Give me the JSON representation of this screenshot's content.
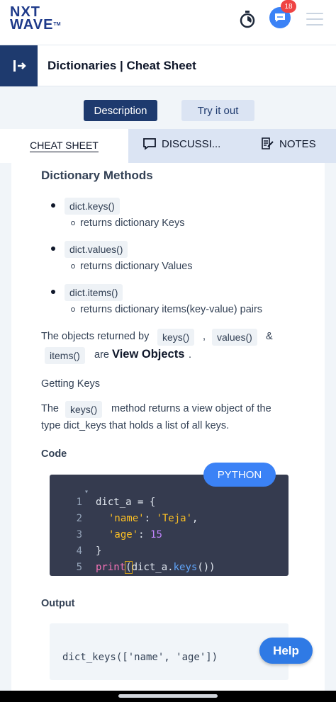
{
  "header": {
    "logo_line1": "NXT",
    "logo_line2": "WAVE",
    "logo_tm": "TM",
    "notification_count": "18"
  },
  "titlebar": {
    "title": "Dictionaries | Cheat Sheet",
    "back_icon": "collapse-arrow-icon"
  },
  "buttons": {
    "description": "Description",
    "try_it_out": "Try it out"
  },
  "tabs": {
    "cheat_sheet": "CHEAT SHEET",
    "discussions": "DISCUSSI...",
    "notes": "NOTES"
  },
  "content": {
    "heading": "Dictionary Methods",
    "methods": [
      {
        "name": "dict.keys()",
        "desc": "returns dictionary Keys"
      },
      {
        "name": "dict.values()",
        "desc": "returns dictionary Values"
      },
      {
        "name": "dict.items()",
        "desc": "returns dictionary items(key-value) pairs"
      }
    ],
    "view_objects": {
      "prefix": "The objects returned by",
      "chip1": "keys()",
      "comma": ",",
      "chip2": "values()",
      "amp": "&",
      "chip3": "items()",
      "are": "are",
      "bold": "View Objects",
      "period": "."
    },
    "getting_keys": "Getting Keys",
    "keys_para": {
      "the": "The",
      "chip": "keys()",
      "rest1": "method returns a view object of the",
      "rest2": "type dict_keys that holds a list of all keys."
    },
    "code_label": "Code",
    "language_tag": "PYTHON",
    "code_lines": [
      {
        "num": "1",
        "text": "dict_a = {"
      },
      {
        "num": "2",
        "key": "'name'",
        "sep": ": ",
        "val": "'Teja'",
        "end": ","
      },
      {
        "num": "3",
        "key": "'age'",
        "sep": ": ",
        "val": "15"
      },
      {
        "num": "4",
        "text": "}"
      },
      {
        "num": "5",
        "kw": "print",
        "open": "(",
        "mid": "dict_a.",
        "fn": "keys",
        "close": "())"
      }
    ],
    "output_label": "Output",
    "output_text": "dict_keys(['name', 'age'])"
  },
  "help_button": "Help"
}
